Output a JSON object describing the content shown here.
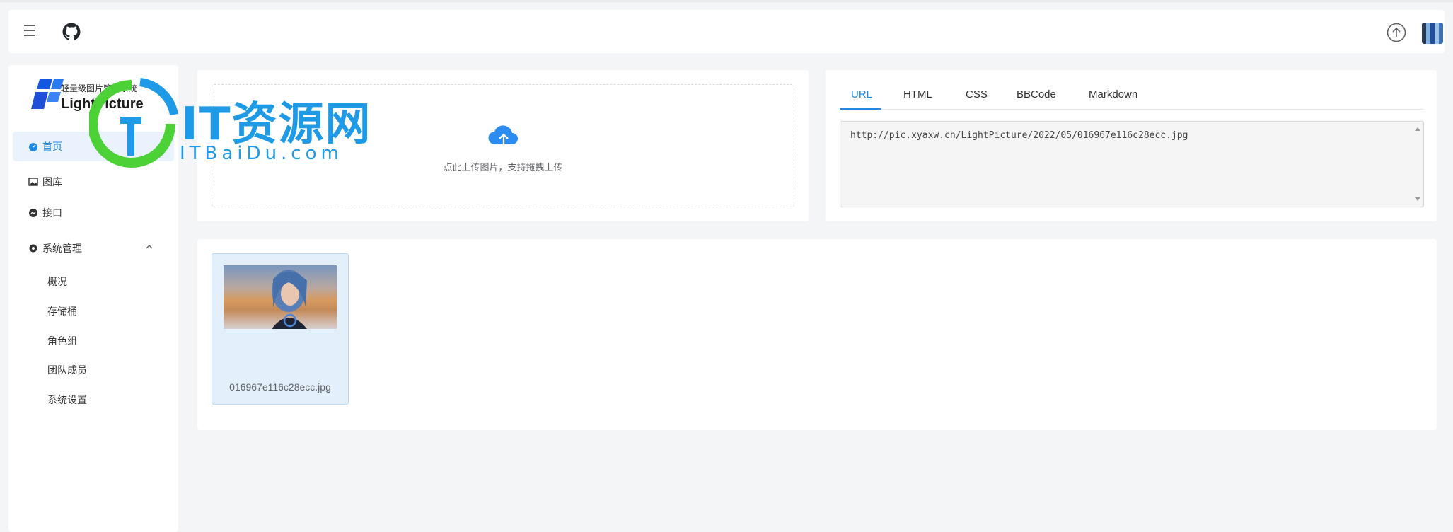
{
  "header": {
    "menu_icon": "hamburger-icon",
    "github_icon": "github-icon",
    "upload_icon": "upload-circle-icon",
    "avatar_icon": "user-avatar"
  },
  "logo": {
    "tagline": "轻量级图片管理系统",
    "name": "LightPicture"
  },
  "sidebar": {
    "items": [
      {
        "label": "首页",
        "icon": "dashboard-icon",
        "active": true
      },
      {
        "label": "图库",
        "icon": "image-icon"
      },
      {
        "label": "接口",
        "icon": "api-icon"
      },
      {
        "label": "系统管理",
        "icon": "gear-icon",
        "expanded": true
      }
    ],
    "submenu": [
      {
        "label": "概况"
      },
      {
        "label": "存储桶"
      },
      {
        "label": "角色组"
      },
      {
        "label": "团队成员"
      },
      {
        "label": "系统设置"
      }
    ]
  },
  "upload": {
    "hint": "点此上传图片，支持拖拽上传",
    "icon": "cloud-upload-icon"
  },
  "link_panel": {
    "tabs": [
      "URL",
      "HTML",
      "CSS",
      "BBCode",
      "Markdown"
    ],
    "active_tab": "URL",
    "value": "http://pic.xyaxw.cn/LightPicture/2022/05/016967e116c28ecc.jpg"
  },
  "gallery": {
    "items": [
      {
        "filename": "016967e116c28ecc.jpg"
      }
    ]
  },
  "watermark": {
    "title": "IT资源网",
    "subtitle": "ITBaiDu.com"
  },
  "colors": {
    "accent": "#1e88e5",
    "background": "#f4f5f7",
    "watermark_blue": "#1e9ae6",
    "watermark_green": "#4cd137"
  }
}
